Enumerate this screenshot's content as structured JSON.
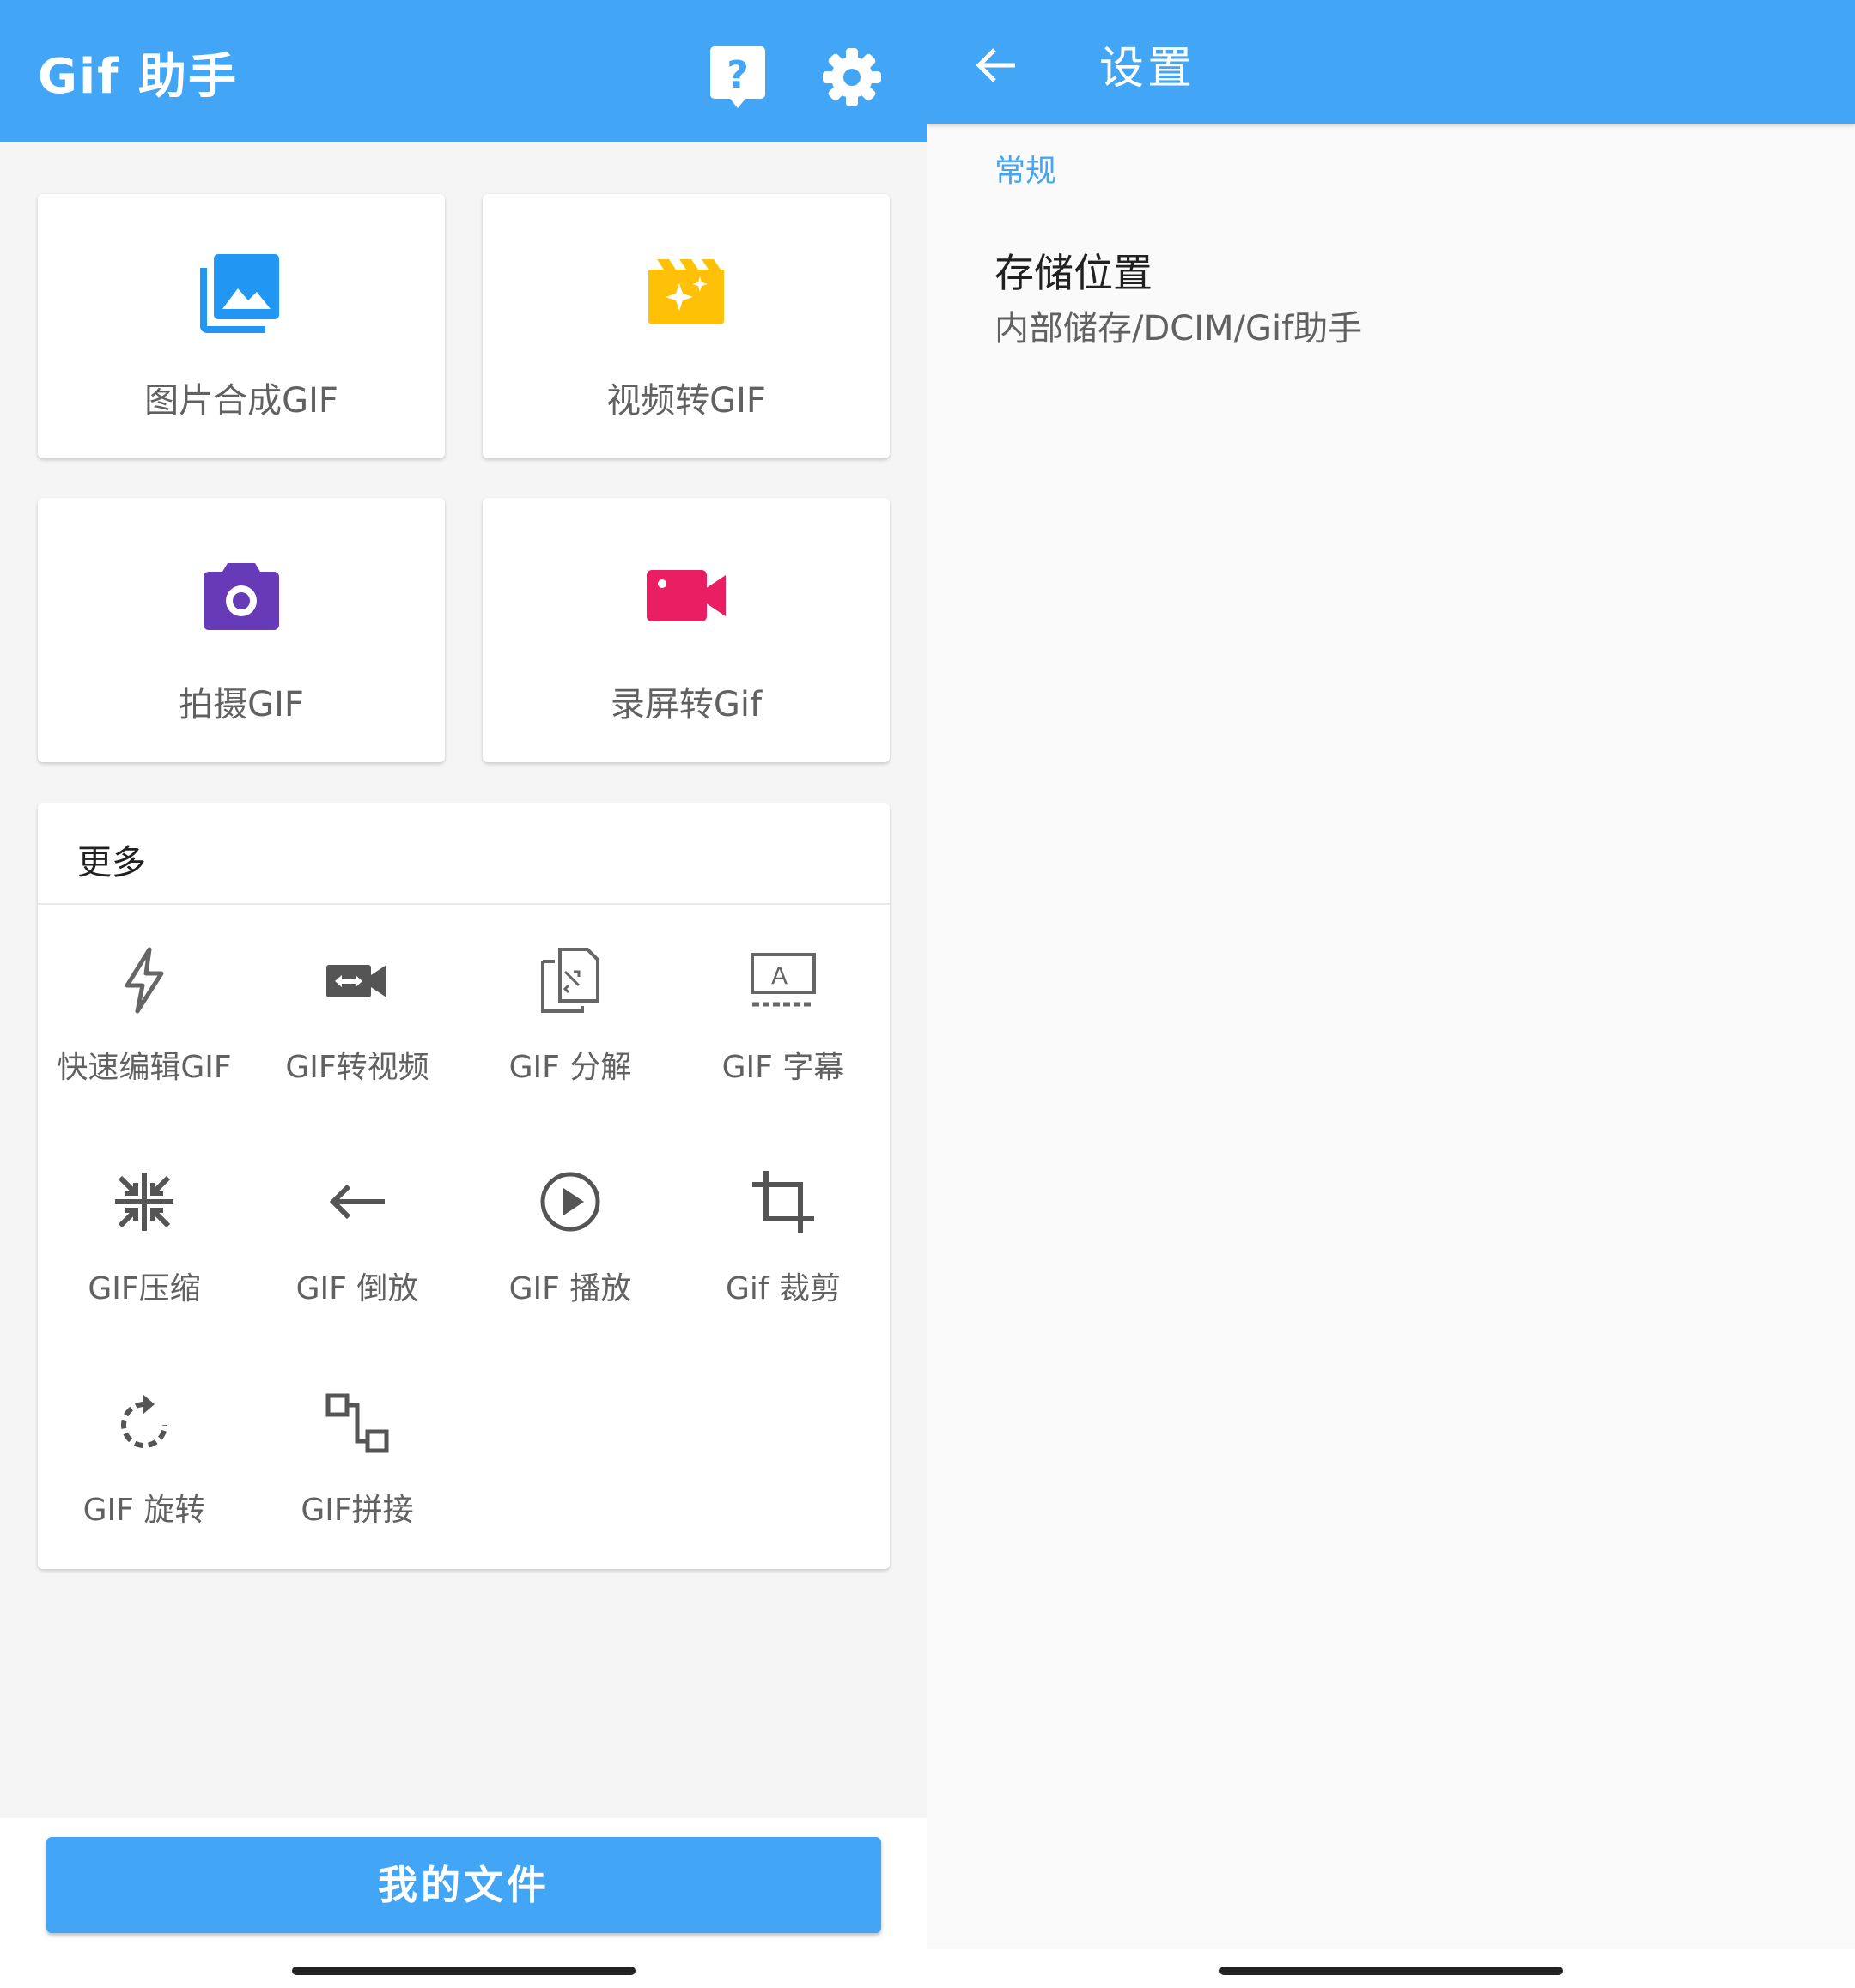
{
  "main": {
    "title": "Gif 助手",
    "features": [
      {
        "label": "图片合成GIF",
        "icon": "photo-library-icon",
        "color": "#2196f3"
      },
      {
        "label": "视频转GIF",
        "icon": "movie-filter-icon",
        "color": "#ffc107"
      },
      {
        "label": "拍摄GIF",
        "icon": "camera-icon",
        "color": "#673ab7"
      },
      {
        "label": "录屏转Gif",
        "icon": "videocam-icon",
        "color": "#e91e63"
      }
    ],
    "more": {
      "title": "更多",
      "tools": [
        {
          "label": "快速编辑GIF",
          "icon": "flash-icon"
        },
        {
          "label": "GIF转视频",
          "icon": "video-convert-icon"
        },
        {
          "label": "GIF 分解",
          "icon": "split-icon"
        },
        {
          "label": "GIF 字幕",
          "icon": "subtitle-icon"
        },
        {
          "label": "GIF压缩",
          "icon": "compress-icon"
        },
        {
          "label": "GIF 倒放",
          "icon": "arrow-back-icon"
        },
        {
          "label": "GIF 播放",
          "icon": "play-circle-icon"
        },
        {
          "label": "Gif 裁剪",
          "icon": "crop-icon"
        },
        {
          "label": "GIF 旋转",
          "icon": "rotate-icon"
        },
        {
          "label": "GIF拼接",
          "icon": "join-icon"
        }
      ]
    },
    "my_files_label": "我的文件",
    "accent": "#42a5f5"
  },
  "settings": {
    "title": "设置",
    "section": "常规",
    "storage": {
      "title": "存储位置",
      "value": "内部储存/DCIM/Gif助手"
    }
  }
}
